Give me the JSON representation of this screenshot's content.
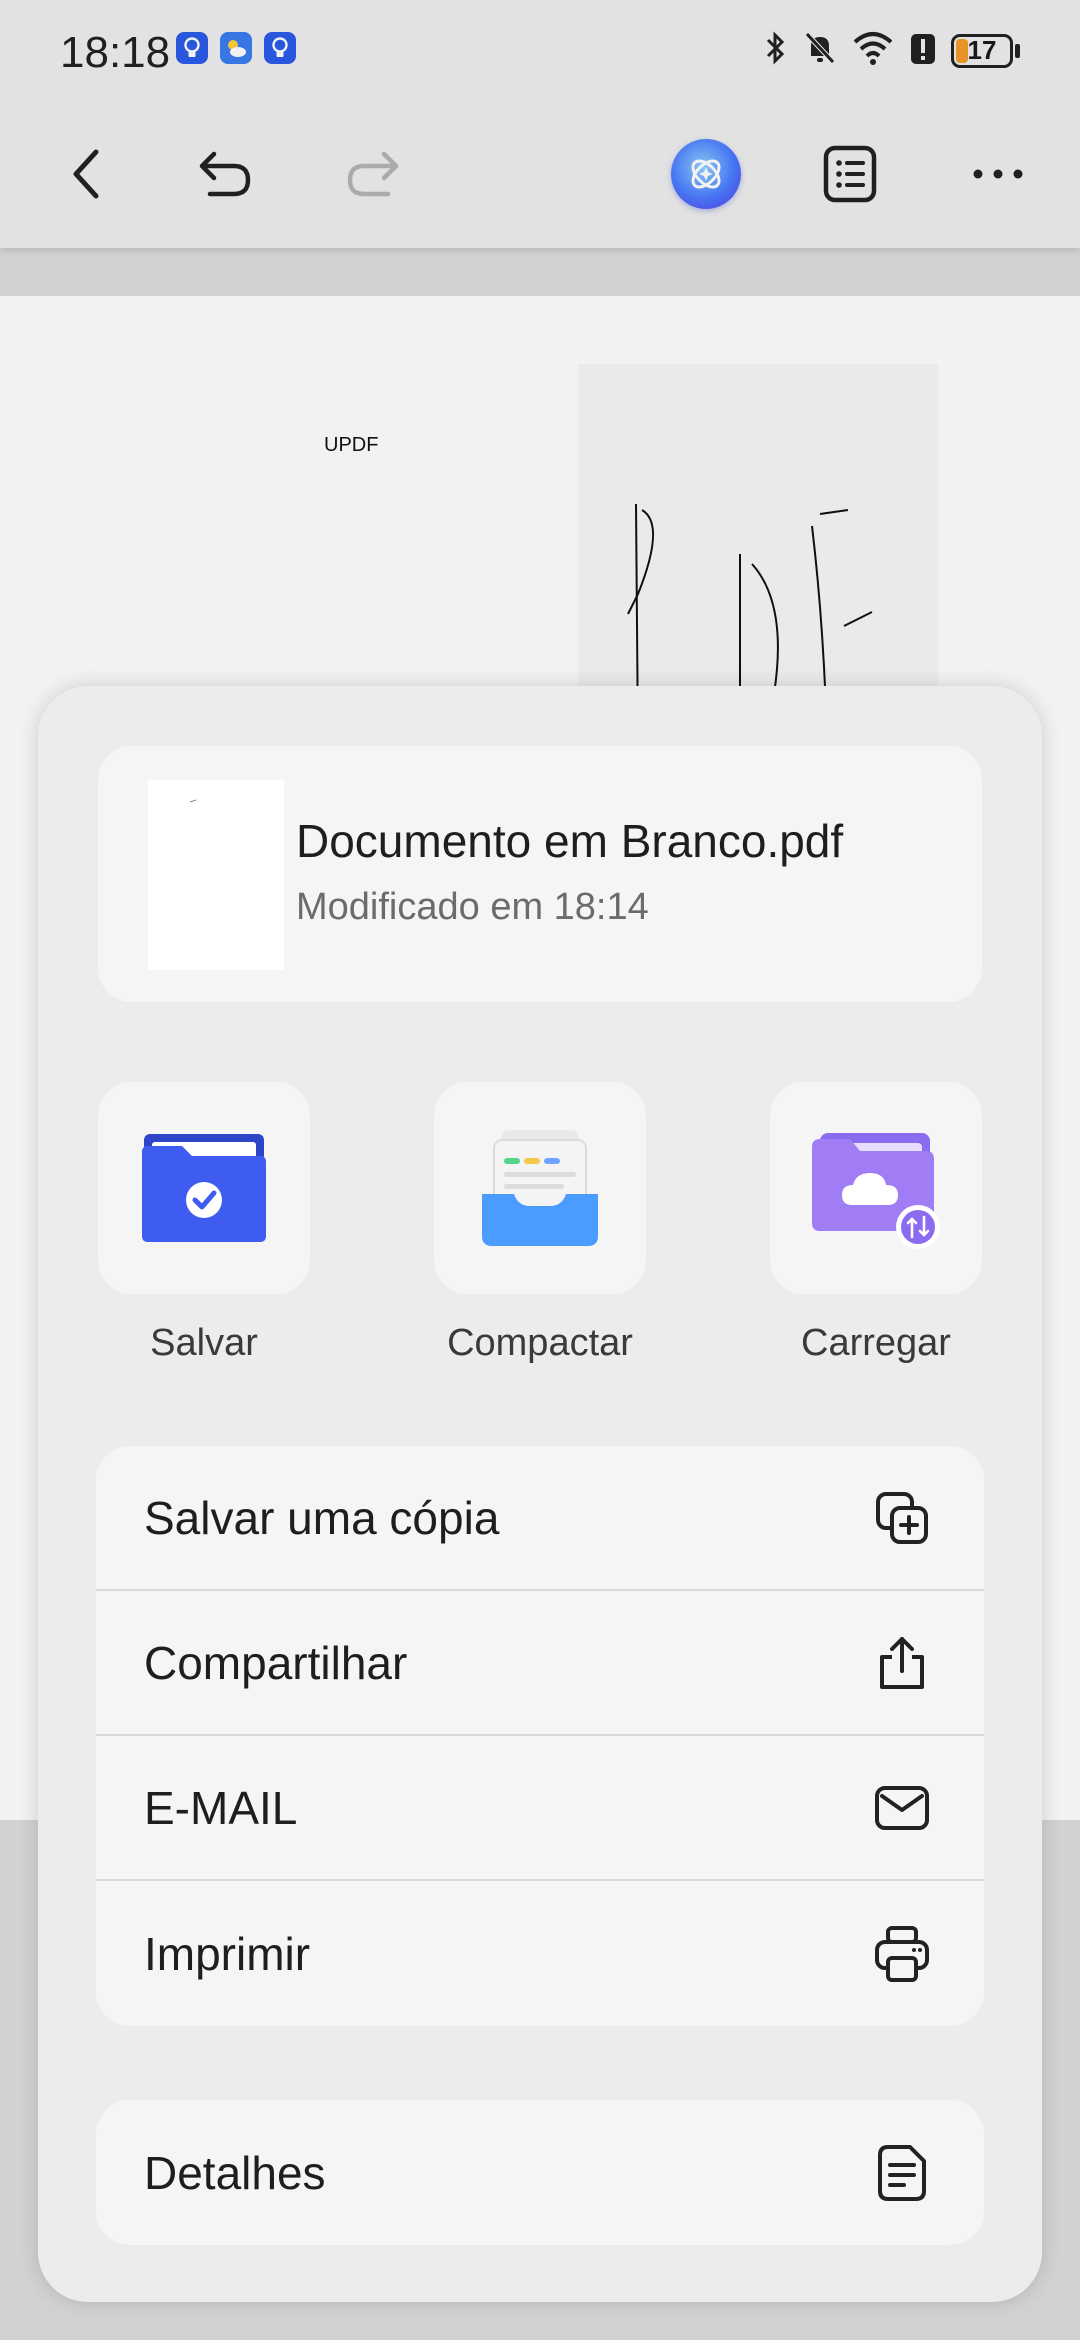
{
  "status_bar": {
    "time": "18:18",
    "battery_level": "17",
    "icons": [
      "bulb-notification-icon",
      "weather-icon",
      "bulb-notification-icon",
      "bluetooth-icon",
      "mute-icon",
      "wifi-icon",
      "alert-icon",
      "battery-icon"
    ]
  },
  "toolbar": {
    "icons": [
      "back-icon",
      "undo-icon",
      "redo-icon",
      "ai-assistant-icon",
      "outline-icon",
      "more-icon"
    ]
  },
  "document": {
    "text": "UPDF"
  },
  "sheet": {
    "file": {
      "name": "Documento em Branco.pdf",
      "modified": "Modificado em 18:14"
    },
    "actions": [
      {
        "label": "Salvar",
        "icon": "save-folder-icon"
      },
      {
        "label": "Compactar",
        "icon": "compress-tray-icon"
      },
      {
        "label": "Carregar",
        "icon": "cloud-upload-folder-icon"
      }
    ],
    "menu": [
      {
        "label": "Salvar uma cópia",
        "icon": "copy-plus-icon"
      },
      {
        "label": "Compartilhar",
        "icon": "share-icon"
      },
      {
        "label": "E-MAIL",
        "icon": "mail-icon"
      },
      {
        "label": "Imprimir",
        "icon": "printer-icon"
      }
    ],
    "details": {
      "label": "Detalhes",
      "icon": "document-lines-icon"
    }
  },
  "colors": {
    "accent_blue": "#3f5cf0",
    "battery_orange": "#f39c2b",
    "sheet_bg": "#ececec",
    "card_bg": "#f5f5f5"
  }
}
